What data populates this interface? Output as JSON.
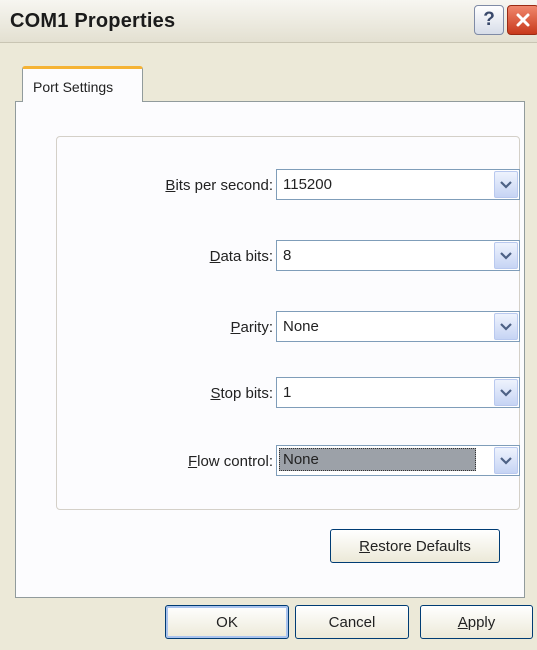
{
  "window": {
    "title": "COM1 Properties",
    "help_label": "?"
  },
  "tabs": [
    {
      "label": "Port Settings"
    }
  ],
  "settings": [
    {
      "mnemonic": "B",
      "rest": "its per second:",
      "value": "115200"
    },
    {
      "mnemonic": "D",
      "rest": "ata bits:",
      "value": "8"
    },
    {
      "mnemonic": "P",
      "rest": "arity:",
      "value": "None"
    },
    {
      "mnemonic": "S",
      "rest": "top bits:",
      "value": "1"
    },
    {
      "mnemonic": "F",
      "rest": "low control:",
      "value": "None"
    }
  ],
  "buttons": {
    "restore_mnemonic": "R",
    "restore_rest": "estore Defaults",
    "ok": "OK",
    "cancel": "Cancel",
    "apply_mnemonic": "A",
    "apply_rest": "pply"
  },
  "colors": {
    "accent_tab": "#f5b335",
    "close_red": "#c8391c",
    "selection_gray": "#9ca1a8"
  }
}
